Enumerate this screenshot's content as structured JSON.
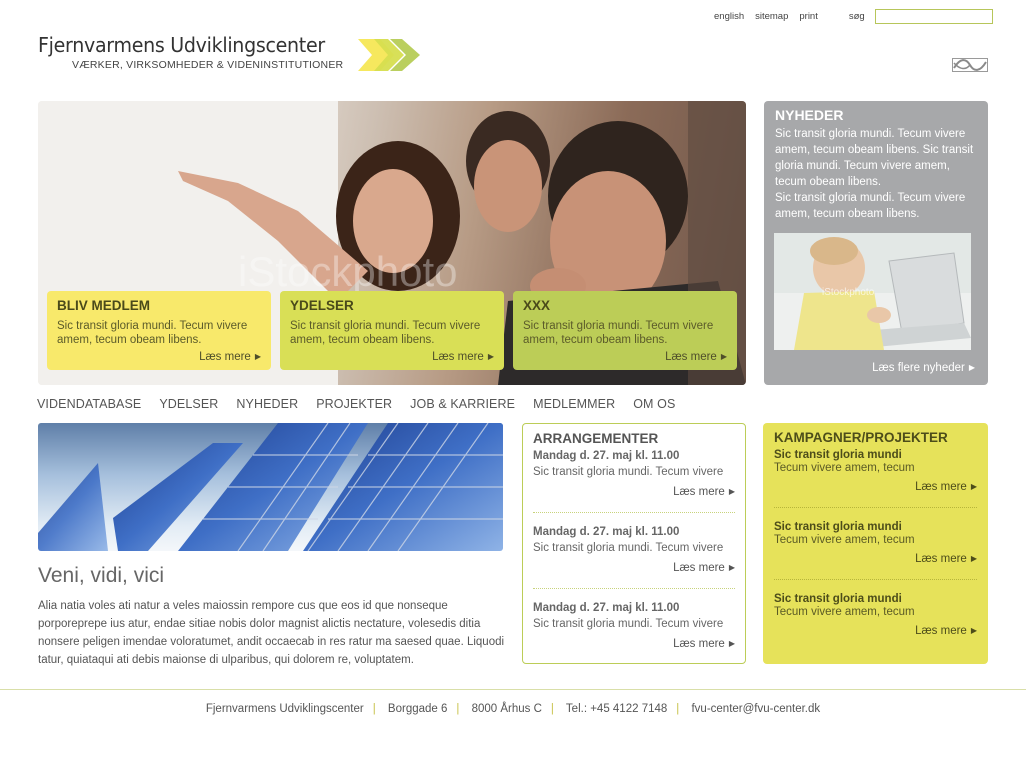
{
  "utility": {
    "links": [
      "english",
      "sitemap",
      "print"
    ],
    "search_label": "søg",
    "search_value": ""
  },
  "logo": {
    "title": "Fjernvarmens Udviklingscenter",
    "subtitle": "VÆRKER, VIRKSOMHEDER & VIDENINSTITUTIONER",
    "arrow_colors": [
      "#f6e85e",
      "#d6de4f",
      "#b6cc56"
    ]
  },
  "hero": {
    "watermark": "iStockphoto",
    "cards": [
      {
        "title": "BLIV MEDLEM",
        "text": "Sic transit gloria mundi. Tecum vivere amem, tecum obeam libens.",
        "more": "Læs mere"
      },
      {
        "title": "YDELSER",
        "text": "Sic transit gloria mundi. Tecum vivere amem, tecum obeam libens.",
        "more": "Læs mere"
      },
      {
        "title": "XXX",
        "text": "Sic transit gloria mundi. Tecum vivere amem, tecum obeam libens.",
        "more": "Læs mere"
      }
    ]
  },
  "news": {
    "title": "NYHEDER",
    "items": [
      "Sic transit gloria mundi. Tecum vivere amem, tecum obeam libens. Sic transit gloria mundi. Tecum vivere amem, tecum obeam libens.",
      "Sic transit gloria mundi. Tecum vivere amem, tecum obeam libens."
    ],
    "more": "Læs flere nyheder"
  },
  "nav": [
    "VIDENDATABASE",
    "YDELSER",
    "NYHEDER",
    "PROJEKTER",
    "JOB & KARRIERE",
    "MEDLEMMER",
    "OM OS"
  ],
  "article": {
    "title": "Veni, vidi, vici",
    "body": "Alia natia voles ati natur a veles maiossin rempore cus que eos id que nonseque porporeprepe ius atur, endae sitiae nobis dolor magnist alictis nectature, volesedis ditia nonsere peligen imendae voloratumet, andit occaecab in res ratur ma saesed quae. Liquodi tatur, quiataqui ati debis maionse di ulparibus, qui dolorem re, voluptatem."
  },
  "events": {
    "title": "ARRANGEMENTER",
    "items": [
      {
        "date": "Mandag d. 27. maj kl. 11.00",
        "text": "Sic transit gloria mundi. Tecum vivere",
        "more": "Læs mere"
      },
      {
        "date": "Mandag d. 27. maj kl. 11.00",
        "text": "Sic transit gloria mundi. Tecum vivere",
        "more": "Læs mere"
      },
      {
        "date": "Mandag d. 27. maj kl. 11.00",
        "text": "Sic transit gloria mundi. Tecum vivere",
        "more": "Læs mere"
      }
    ]
  },
  "campaigns": {
    "title": "KAMPAGNER/PROJEKTER",
    "items": [
      {
        "title": "Sic transit gloria mundi",
        "text": "Tecum vivere amem, tecum",
        "more": "Læs mere"
      },
      {
        "title": "Sic transit gloria mundi",
        "text": "Tecum vivere amem, tecum",
        "more": "Læs mere"
      },
      {
        "title": "Sic transit gloria mundi",
        "text": "Tecum vivere amem, tecum",
        "more": "Læs mere"
      }
    ]
  },
  "footer": {
    "name": "Fjernvarmens Udviklingscenter",
    "street": "Borggade 6",
    "city": "8000 Århus C",
    "phone": "Tel.: +45 4122 7148",
    "email": "fvu-center@fvu-center.dk"
  },
  "colors": {
    "yellow": "#f8e96b",
    "lime": "#d9df56",
    "green": "#bccd57",
    "news_gray": "#a7a8aa",
    "campaign_yellow": "#e6e25a"
  },
  "icons": {
    "arrow": "triangle-right",
    "corner_logo": "district-heating-logo"
  }
}
